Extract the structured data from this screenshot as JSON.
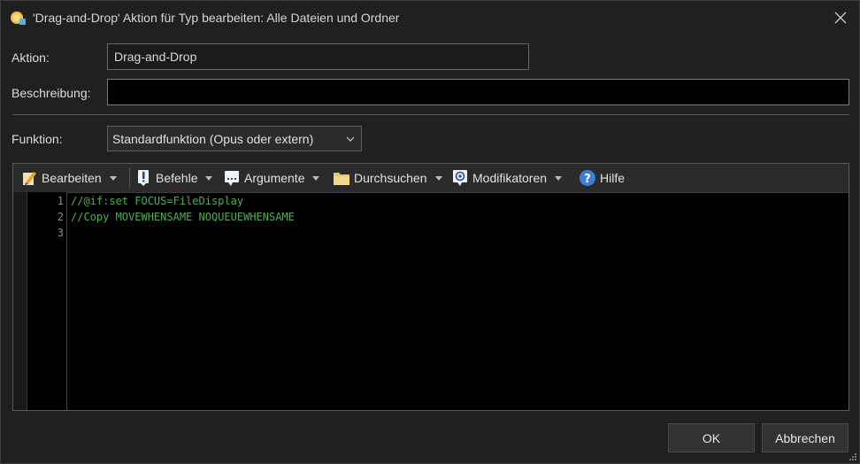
{
  "window": {
    "title": "'Drag-and-Drop' Aktion für Typ bearbeiten: Alle Dateien und Ordner"
  },
  "form": {
    "aktion_label": "Aktion:",
    "aktion_value": "Drag-and-Drop",
    "beschreibung_label": "Beschreibung:",
    "beschreibung_value": "",
    "funktion_label": "Funktion:",
    "funktion_value": "Standardfunktion (Opus oder extern)"
  },
  "toolbar": {
    "items": [
      {
        "label": "Bearbeiten",
        "icon": "edit-pencil-icon"
      },
      {
        "label": "Befehle",
        "icon": "command-icon"
      },
      {
        "label": "Argumente",
        "icon": "arguments-icon"
      },
      {
        "label": "Durchsuchen",
        "icon": "folder-icon"
      },
      {
        "label": "Modifikatoren",
        "icon": "modifier-icon"
      },
      {
        "label": "Hilfe",
        "icon": "help-icon"
      }
    ]
  },
  "editor": {
    "lines": [
      {
        "number": "1",
        "text": "//@if:set FOCUS=FileDisplay"
      },
      {
        "number": "2",
        "text": "//Copy MOVEWHENSAME NOQUEUEWHENSAME"
      },
      {
        "number": "3",
        "text": ""
      }
    ],
    "comment_color": "#4caf50"
  },
  "buttons": {
    "ok": "OK",
    "cancel": "Abbrechen"
  }
}
